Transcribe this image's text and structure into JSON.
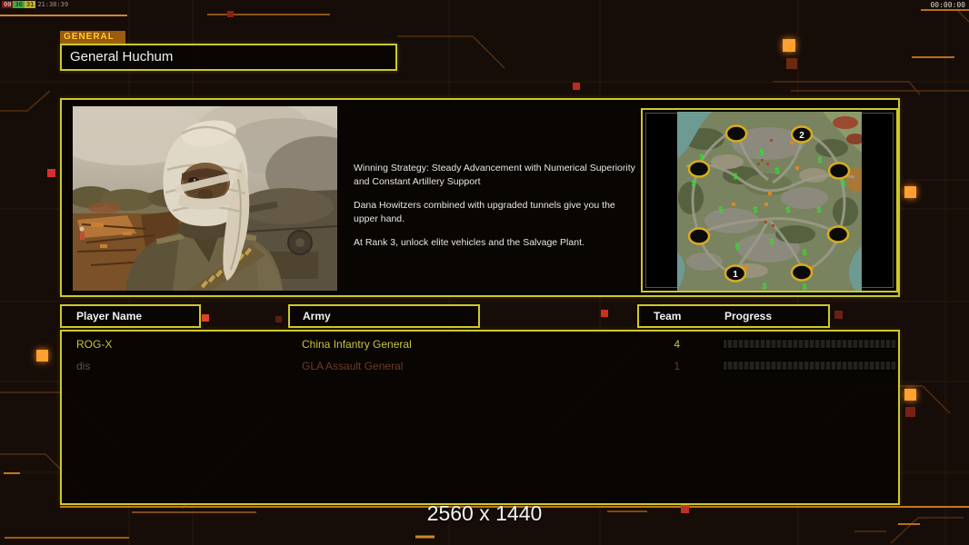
{
  "status_bar": {
    "values": [
      "00",
      "30",
      "31"
    ],
    "clock": "21:38:39",
    "timer": "00:00:00"
  },
  "general": {
    "tab_label": "GENERAL",
    "name": "General Huchum",
    "strategy": [
      "Winning Strategy: Steady Advancement with Numerical Superiority and Constant Artillery Support",
      "Dana Howitzers combined with upgraded tunnels give you the upper hand.",
      "At Rank 3, unlock elite vehicles and the Salvage Plant."
    ]
  },
  "map_preview": {
    "start_labels": {
      "one": "1",
      "two": "2"
    },
    "start_position_count": 8
  },
  "lobby_table": {
    "headers": {
      "player_name": "Player Name",
      "army": "Army",
      "team": "Team",
      "progress": "Progress"
    },
    "rows": [
      {
        "player_name": "ROG-X",
        "army": "China Infantry General",
        "team": "4"
      },
      {
        "player_name": "dis",
        "army": "GLA Assault General",
        "team": "1"
      }
    ]
  },
  "footer": {
    "resolution": "2560 x 1440"
  },
  "colors": {
    "panel_border": "#cfc827",
    "accent_orange": "#ff8c1a",
    "alert_red": "#d83028",
    "active_row": "#c6c63c",
    "inactive_player": "#5e5448",
    "inactive_army": "#713a28",
    "tab_background": "#9a5c10",
    "tab_text": "#ffd428",
    "map_marker_ring": "#d8ac1e",
    "supply_green": "#2ee02e"
  }
}
